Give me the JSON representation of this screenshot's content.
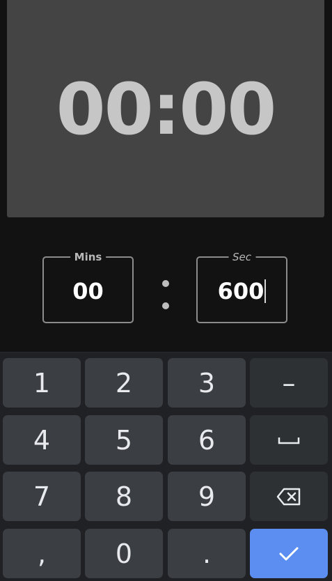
{
  "timer": {
    "display": "00:00"
  },
  "fields": {
    "mins": {
      "label": "Mins",
      "value": "00"
    },
    "secs": {
      "label": "Sec",
      "value": "600"
    }
  },
  "keyboard": {
    "keys": {
      "k1": "1",
      "k2": "2",
      "k3": "3",
      "k4": "4",
      "k5": "5",
      "k6": "6",
      "k7": "7",
      "k8": "8",
      "k9": "9",
      "comma": ",",
      "k0": "0",
      "period": ".",
      "minus": "–"
    },
    "icons": {
      "space": "space-icon",
      "backspace": "backspace-icon",
      "done": "checkmark-icon"
    },
    "accent_color": "#5b8ef0"
  }
}
